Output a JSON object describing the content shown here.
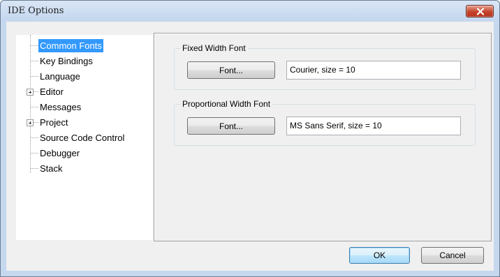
{
  "window": {
    "title": "IDE Options"
  },
  "tree": {
    "items": [
      {
        "label": "Common Fonts",
        "selected": true,
        "expandable": false
      },
      {
        "label": "Key Bindings",
        "selected": false,
        "expandable": false
      },
      {
        "label": "Language",
        "selected": false,
        "expandable": false
      },
      {
        "label": "Editor",
        "selected": false,
        "expandable": true
      },
      {
        "label": "Messages",
        "selected": false,
        "expandable": false
      },
      {
        "label": "Project",
        "selected": false,
        "expandable": true
      },
      {
        "label": "Source Code Control",
        "selected": false,
        "expandable": false
      },
      {
        "label": "Debugger",
        "selected": false,
        "expandable": false
      },
      {
        "label": "Stack",
        "selected": false,
        "expandable": false
      }
    ]
  },
  "fixed_font": {
    "title": "Fixed Width Font",
    "button_label": "Font...",
    "value": "Courier, size = 10"
  },
  "proportional_font": {
    "title": "Proportional Width Font",
    "button_label": "Font...",
    "value": "MS Sans Serif, size = 10"
  },
  "buttons": {
    "ok": "OK",
    "cancel": "Cancel"
  },
  "colors": {
    "selection": "#3399ff",
    "title_bar": "#c6d8ee",
    "close_button": "#c5432b",
    "dialog_face": "#f0f0f0"
  }
}
